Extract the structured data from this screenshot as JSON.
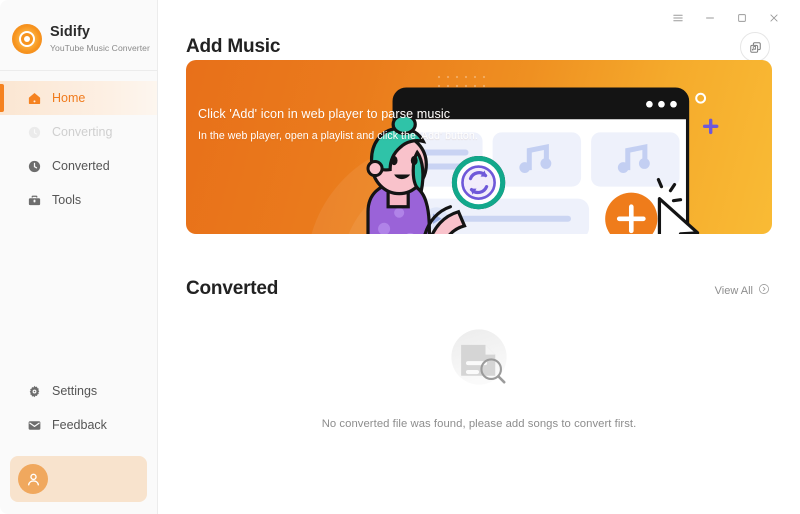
{
  "app": {
    "brand_name": "Sidify",
    "brand_tagline": "YouTube Music Converter",
    "accent_color": "#f58220",
    "sidebar_bg": "#fafafa"
  },
  "titlebar": {
    "menu_label": "Menu",
    "minimize_label": "Minimize",
    "maximize_label": "Maximize",
    "close_label": "Close"
  },
  "sidebar": {
    "items": [
      {
        "label": "Home",
        "icon": "home-icon",
        "active": true,
        "disabled": false
      },
      {
        "label": "Converting",
        "icon": "converting-icon",
        "active": false,
        "disabled": true
      },
      {
        "label": "Converted",
        "icon": "clock-icon",
        "active": false,
        "disabled": false
      },
      {
        "label": "Tools",
        "icon": "toolbox-icon",
        "active": false,
        "disabled": false
      }
    ],
    "bottom_items": [
      {
        "label": "Settings",
        "icon": "gear-icon"
      },
      {
        "label": "Feedback",
        "icon": "envelope-icon"
      }
    ],
    "account": {
      "name_masked": "",
      "email_masked": "",
      "icon": "user-avatar-icon"
    }
  },
  "main": {
    "page_title": "Add Music",
    "library_button_label": "Library",
    "banner": {
      "headline": "Click 'Add' icon in web player to parse music",
      "subline": "In the web player, open a playlist and click the 'Add' button.",
      "add_button_label": "+",
      "gradient_from": "#e8701a",
      "gradient_to": "#f9bb35"
    },
    "converted": {
      "section_title": "Converted",
      "view_all_label": "View All",
      "view_all_icon": "chevron-right-circle-icon",
      "empty_message": "No converted file was found, please add songs to convert first.",
      "empty_icon": "document-search-icon"
    }
  }
}
